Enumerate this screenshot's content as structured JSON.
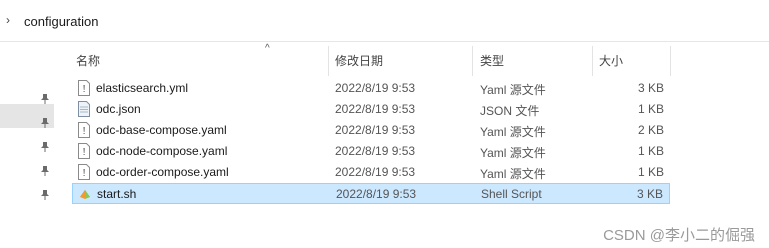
{
  "address": {
    "crumb": "configuration"
  },
  "columns": {
    "name": "名称",
    "date": "修改日期",
    "type": "类型",
    "size": "大小"
  },
  "files": [
    {
      "name": "elasticsearch.yml",
      "date": "2022/8/19 9:53",
      "type": "Yaml 源文件",
      "size": "3 KB",
      "icon": "yaml-file-icon"
    },
    {
      "name": "odc.json",
      "date": "2022/8/19 9:53",
      "type": "JSON 文件",
      "size": "1 KB",
      "icon": "json-file-icon"
    },
    {
      "name": "odc-base-compose.yaml",
      "date": "2022/8/19 9:53",
      "type": "Yaml 源文件",
      "size": "2 KB",
      "icon": "yaml-file-icon"
    },
    {
      "name": "odc-node-compose.yaml",
      "date": "2022/8/19 9:53",
      "type": "Yaml 源文件",
      "size": "1 KB",
      "icon": "yaml-file-icon"
    },
    {
      "name": "odc-order-compose.yaml",
      "date": "2022/8/19 9:53",
      "type": "Yaml 源文件",
      "size": "1 KB",
      "icon": "yaml-file-icon"
    },
    {
      "name": "start.sh",
      "date": "2022/8/19 9:53",
      "type": "Shell Script",
      "size": "3 KB",
      "icon": "shell-script-icon",
      "selected": true
    }
  ],
  "watermark": "CSDN @李小二的倔强",
  "colors": {
    "selection_bg": "#cce8ff",
    "selection_border": "#99d1ff",
    "nav_selected": "#e5e5e5"
  }
}
